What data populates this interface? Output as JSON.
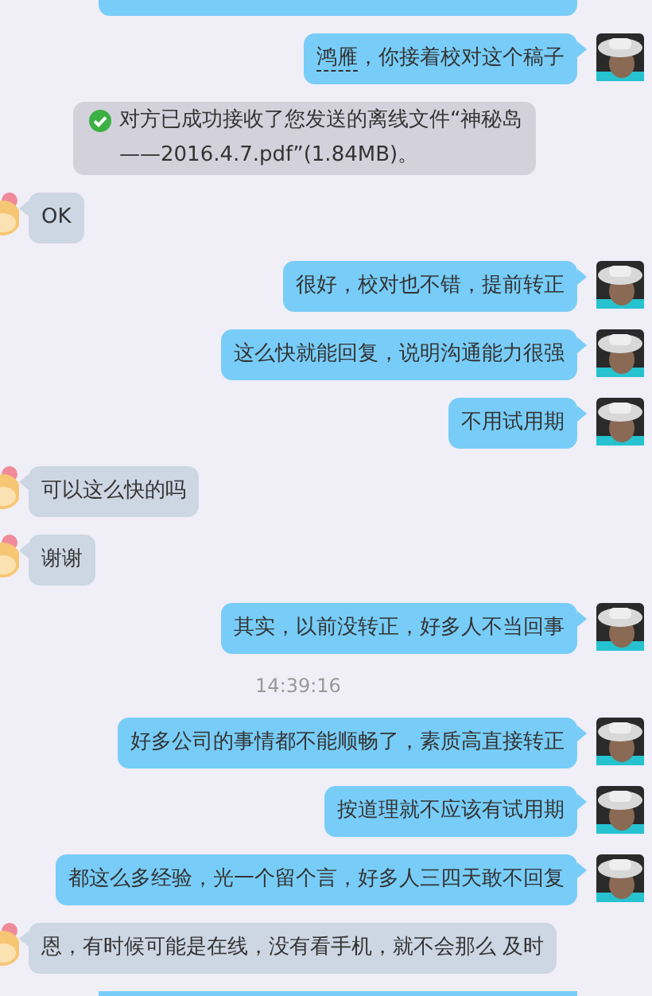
{
  "messages": [
    {
      "kind": "sent-cut"
    },
    {
      "kind": "sent",
      "mention": "鸿雁",
      "text": "，你接着校对这个稿子"
    },
    {
      "kind": "notice",
      "text": "对方已成功接收了您发送的离线文件“神秘岛——2016.4.7.pdf”(1.84MB)。"
    },
    {
      "kind": "received",
      "text": "OK"
    },
    {
      "kind": "sent",
      "text": "很好，校对也不错，提前转正"
    },
    {
      "kind": "sent",
      "text": "这么快就能回复，说明沟通能力很强"
    },
    {
      "kind": "sent",
      "text": "不用试用期"
    },
    {
      "kind": "received",
      "text": "可以这么快的吗"
    },
    {
      "kind": "received",
      "text": "谢谢"
    },
    {
      "kind": "sent",
      "text": "其实，以前没转正，好多人不当回事"
    },
    {
      "kind": "time",
      "text": "14:39:16"
    },
    {
      "kind": "sent",
      "text": "好多公司的事情都不能顺畅了，素质高直接转正"
    },
    {
      "kind": "sent",
      "text": "按道理就不应该有试用期"
    },
    {
      "kind": "sent",
      "text": "都这么多经验，光一个留个言，好多人三四天敢不回复"
    },
    {
      "kind": "received",
      "text": "恩，有时候可能是在线，没有看手机，就不会那么 及时"
    },
    {
      "kind": "sent-cut"
    }
  ]
}
